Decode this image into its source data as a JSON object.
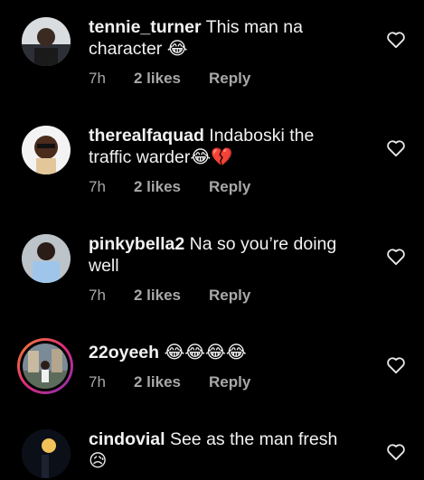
{
  "comments": [
    {
      "username": "tennie_turner",
      "text": "This man na character 😂",
      "time": "7h",
      "likes": "2 likes",
      "reply": "Reply",
      "avatar": "tennie-avatar"
    },
    {
      "username": "therealfaquad",
      "text": "Indaboski the traffic warder😂💔",
      "time": "7h",
      "likes": "2 likes",
      "reply": "Reply",
      "avatar": "faquad-avatar"
    },
    {
      "username": "pinkybella2",
      "text": "Na so you’re doing well",
      "time": "7h",
      "likes": "2 likes",
      "reply": "Reply",
      "avatar": "pinky-avatar"
    },
    {
      "username": "22oyeeh",
      "text": "😂😂😂😂",
      "time": "7h",
      "likes": "2 likes",
      "reply": "Reply",
      "avatar": "oyeeh-avatar"
    },
    {
      "username": "cindovial",
      "text": "See as the man fresh 😥",
      "time": "",
      "likes": "",
      "reply": "",
      "avatar": "cindovial-avatar"
    }
  ],
  "icons": {
    "like": "heart-outline-icon"
  },
  "colors": {
    "background": "#000000",
    "text": "#f2f2f2",
    "meta": "#a8a8a8",
    "story_ring": "#dd2a7b"
  }
}
